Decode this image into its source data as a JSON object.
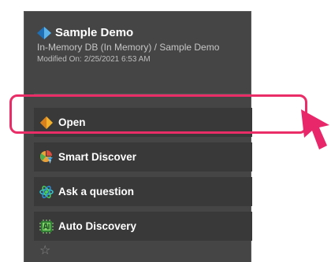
{
  "header": {
    "title": "Sample Demo",
    "path": "In-Memory DB (In Memory) / Sample Demo",
    "modified_label": "Modified On:",
    "modified_value": "2/25/2021 6:53 AM"
  },
  "menu": {
    "items": [
      {
        "label": "Open",
        "icon": "open-icon"
      },
      {
        "label": "Smart Discover",
        "icon": "smart-discover-icon"
      },
      {
        "label": "Ask a question",
        "icon": "ask-question-icon"
      },
      {
        "label": "Auto Discovery",
        "icon": "auto-discovery-icon"
      }
    ]
  },
  "colors": {
    "panel_bg": "#454545",
    "item_bg": "#393939",
    "highlight": "#ea2d67",
    "accent_blue": "#3aa0e0",
    "accent_orange": "#f0a020"
  }
}
